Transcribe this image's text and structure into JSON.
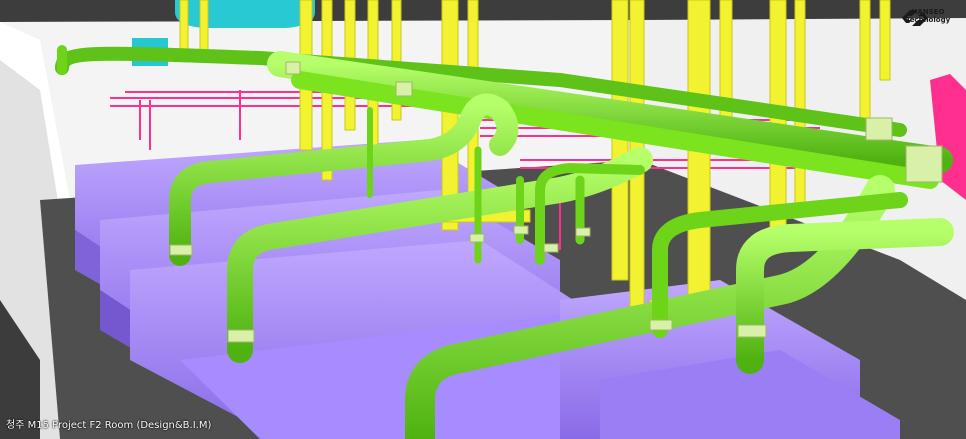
{
  "logo": {
    "line1": "HANSEO",
    "line2": "Technology"
  },
  "caption": "청주 M15 Project F2 Room (Design&B.I.M)",
  "colors": {
    "floor": "#4d4d4d",
    "ceiling": "#3a3a3a",
    "wall": "#f2f2f2",
    "equipment_purple": "#9a7cf2",
    "pipe_green": "#76e21c",
    "pipe_yellow": "#f2f230",
    "pipe_magenta": "#ff2f8f",
    "duct_cyan": "#1fc9d1"
  }
}
